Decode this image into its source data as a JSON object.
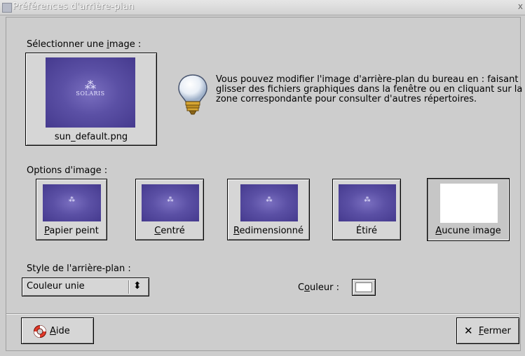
{
  "window": {
    "title": "Préférences d'arrière-plan",
    "close_glyph": "x"
  },
  "select_image": {
    "label_pre": "Sélectionner une ",
    "label_key": "i",
    "label_post": "mage :",
    "filename": "sun_default.png",
    "logo_text": "SOLARIS"
  },
  "info": {
    "text": "Vous pouvez modifier l'image d'arrière-plan du bureau en : faisant glisser des fichiers graphiques dans la fenêtre ou en cliquant sur la zone correspondante pour consulter d'autres répertoires."
  },
  "options": {
    "label": "Options d'image :",
    "items": [
      {
        "key": "P",
        "rest": "apier peint"
      },
      {
        "key": "C",
        "rest": "entré"
      },
      {
        "key": "R",
        "rest": "edimensionné"
      },
      {
        "key": "",
        "rest": "Étiré"
      },
      {
        "key": "A",
        "rest": "ucune image"
      }
    ]
  },
  "background_style": {
    "label": "Style de l'arrière-plan :",
    "value": "Couleur unie",
    "spinner_glyph": "⬍"
  },
  "color": {
    "pre": "C",
    "key": "o",
    "post": "uleur :",
    "value": "#ffffff"
  },
  "buttons": {
    "help": {
      "key": "A",
      "rest": "ide"
    },
    "close": {
      "icon": "✕",
      "key": "F",
      "rest": "ermer"
    }
  }
}
